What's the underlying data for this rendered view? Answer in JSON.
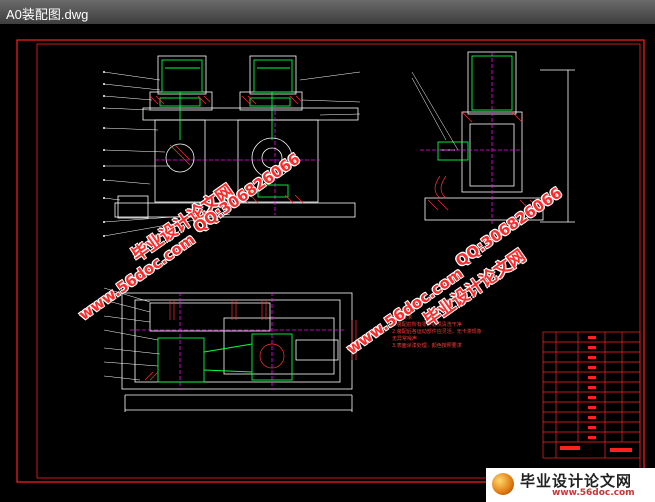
{
  "window": {
    "title": "A0装配图.dwg"
  },
  "watermarks": {
    "url": "www.56doc.com",
    "qq": "QQ:306826066",
    "site": "毕业设计论文网"
  },
  "notes": {
    "heading": "技术要求",
    "lines": [
      "1.装配前所有零件必须清洗干净",
      "2.装配后各运动部件应灵活，无卡滞现象",
      "  无异常噪声",
      "3.表面涂漆处理，颜色按照要求"
    ]
  },
  "footer": {
    "site": "毕业设计论文网",
    "url": "www.56doc.com"
  },
  "colors": {
    "frame": "#ff2020",
    "geometry": "#ffffff",
    "parts": "#00ff40",
    "hatch": "#ff3030",
    "center": "#ff00ff"
  }
}
